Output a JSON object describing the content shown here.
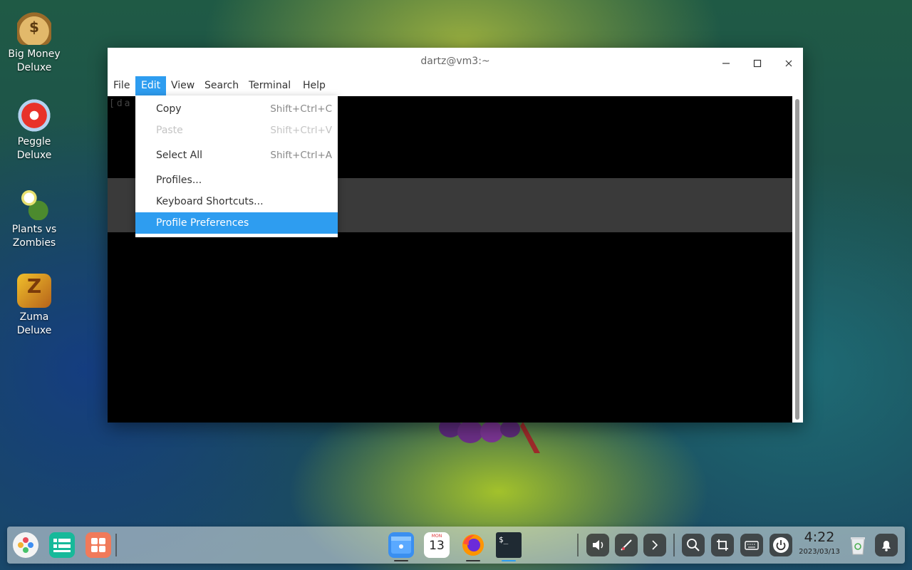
{
  "desktop_icons": [
    {
      "label": "Big Money Deluxe",
      "icon": "money-bag-icon"
    },
    {
      "label": "Peggle Deluxe",
      "icon": "peggle-icon"
    },
    {
      "label": "Plants vs Zombies",
      "icon": "plants-vs-zombies-icon"
    },
    {
      "label": "Zuma Deluxe",
      "icon": "zuma-icon"
    }
  ],
  "window": {
    "title": "dartz@vm3:~",
    "menu": [
      "File",
      "Edit",
      "View",
      "Search",
      "Terminal",
      "Help"
    ],
    "active_menu": "Edit",
    "terminal_prompt": "[da"
  },
  "edit_menu": {
    "items": [
      {
        "label": "Copy",
        "accel": "Shift+Ctrl+C",
        "enabled": true
      },
      {
        "label": "Paste",
        "accel": "Shift+Ctrl+V",
        "enabled": false
      },
      {
        "label": "Select All",
        "accel": "Shift+Ctrl+A",
        "enabled": true
      },
      {
        "label": "Profiles...",
        "accel": "",
        "enabled": true
      },
      {
        "label": "Keyboard Shortcuts...",
        "accel": "",
        "enabled": true
      },
      {
        "label": "Profile Preferences",
        "accel": "",
        "enabled": true,
        "highlighted": true
      }
    ]
  },
  "taskbar": {
    "clock_time": "4:22",
    "clock_date": "2023/03/13",
    "calendar_day": "13",
    "calendar_weekday": "MON",
    "terminal_glyph": "$_"
  },
  "colors": {
    "accent": "#2e9df0",
    "terminal_bg": "#000000"
  }
}
